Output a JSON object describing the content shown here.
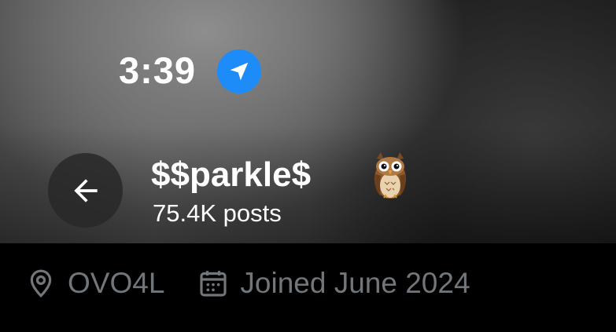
{
  "status_bar": {
    "time": "3:39",
    "location_icon": "location-arrow-icon",
    "location_icon_color": "#1d8cf8"
  },
  "profile_header": {
    "back_icon": "arrow-left-icon",
    "display_name": "$$parkle$",
    "name_emoji": "owl",
    "posts_count": "75.4K posts"
  },
  "profile_info": {
    "location_icon": "map-pin-icon",
    "location": "OVO4L",
    "joined_icon": "calendar-icon",
    "joined": "Joined June 2024",
    "text_color": "#71767b"
  }
}
